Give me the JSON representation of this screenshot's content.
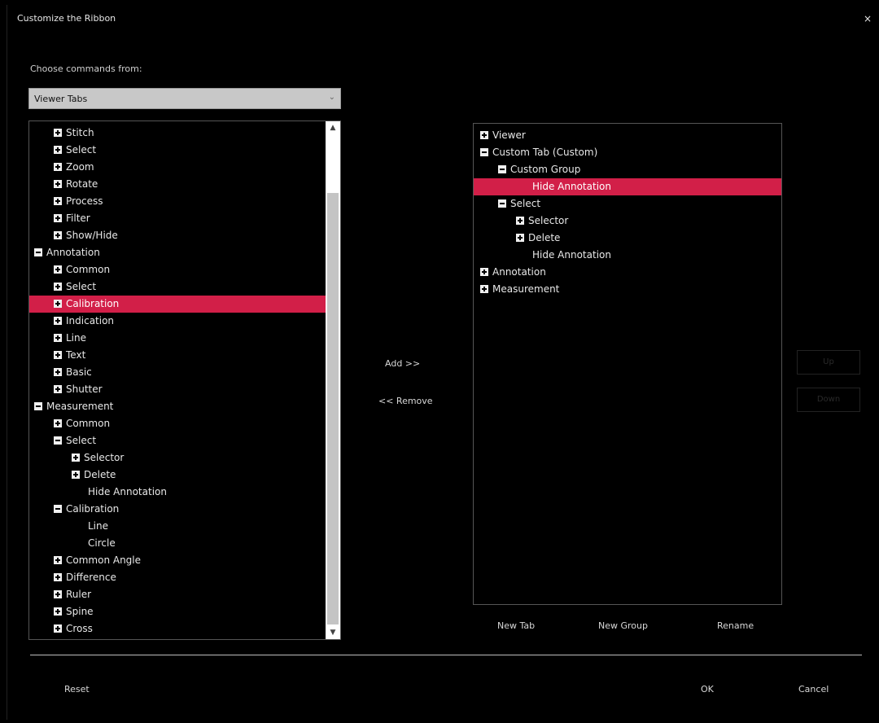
{
  "window": {
    "title": "Customize the Ribbon",
    "close_label": "×"
  },
  "choose": {
    "label": "Choose commands from:",
    "selected": "Viewer Tabs"
  },
  "left_tree": [
    {
      "label": "Stitch",
      "level": 1,
      "expander": "plus"
    },
    {
      "label": "Select",
      "level": 1,
      "expander": "plus"
    },
    {
      "label": "Zoom",
      "level": 1,
      "expander": "plus"
    },
    {
      "label": "Rotate",
      "level": 1,
      "expander": "plus"
    },
    {
      "label": "Process",
      "level": 1,
      "expander": "plus"
    },
    {
      "label": "Filter",
      "level": 1,
      "expander": "plus"
    },
    {
      "label": "Show/Hide",
      "level": 1,
      "expander": "plus"
    },
    {
      "label": "Annotation",
      "level": 0,
      "expander": "minus"
    },
    {
      "label": "Common",
      "level": 1,
      "expander": "plus"
    },
    {
      "label": "Select",
      "level": 1,
      "expander": "plus"
    },
    {
      "label": "Calibration",
      "level": 1,
      "expander": "plus",
      "selected": true
    },
    {
      "label": "Indication",
      "level": 1,
      "expander": "plus"
    },
    {
      "label": "Line",
      "level": 1,
      "expander": "plus"
    },
    {
      "label": "Text",
      "level": 1,
      "expander": "plus"
    },
    {
      "label": "Basic",
      "level": 1,
      "expander": "plus"
    },
    {
      "label": "Shutter",
      "level": 1,
      "expander": "plus"
    },
    {
      "label": "Measurement",
      "level": 0,
      "expander": "minus"
    },
    {
      "label": "Common",
      "level": 1,
      "expander": "plus"
    },
    {
      "label": "Select",
      "level": 1,
      "expander": "minus"
    },
    {
      "label": "Selector",
      "level": 2,
      "expander": "plus"
    },
    {
      "label": "Delete",
      "level": 2,
      "expander": "plus"
    },
    {
      "label": "Hide Annotation",
      "level": 3,
      "expander": "none"
    },
    {
      "label": "Calibration",
      "level": 1,
      "expander": "minus"
    },
    {
      "label": "Line",
      "level": 3,
      "expander": "none"
    },
    {
      "label": "Circle",
      "level": 3,
      "expander": "none"
    },
    {
      "label": "Common Angle",
      "level": 1,
      "expander": "plus"
    },
    {
      "label": "Difference",
      "level": 1,
      "expander": "plus"
    },
    {
      "label": "Ruler",
      "level": 1,
      "expander": "plus"
    },
    {
      "label": "Spine",
      "level": 1,
      "expander": "plus"
    },
    {
      "label": "Cross",
      "level": 1,
      "expander": "plus"
    }
  ],
  "scroll": {
    "up": "▲",
    "down": "▼"
  },
  "transfer": {
    "add": "Add >>",
    "remove": "<< Remove"
  },
  "right_tree": [
    {
      "label": "Viewer",
      "level": 0,
      "expander": "plus"
    },
    {
      "label": "Custom Tab (Custom)",
      "level": 0,
      "expander": "minus"
    },
    {
      "label": "Custom Group",
      "level": 1,
      "expander": "minus"
    },
    {
      "label": "Hide Annotation",
      "level": 3,
      "expander": "none",
      "selected": true
    },
    {
      "label": "Select",
      "level": 1,
      "expander": "minus"
    },
    {
      "label": "Selector",
      "level": 2,
      "expander": "plus"
    },
    {
      "label": "Delete",
      "level": 2,
      "expander": "plus"
    },
    {
      "label": "Hide Annotation",
      "level": 3,
      "expander": "none"
    },
    {
      "label": "Annotation",
      "level": 0,
      "expander": "plus"
    },
    {
      "label": "Measurement",
      "level": 0,
      "expander": "plus"
    }
  ],
  "order": {
    "up": "Up",
    "down": "Down"
  },
  "right_buttons": {
    "new_tab": "New Tab",
    "new_group": "New Group",
    "rename": "Rename"
  },
  "footer": {
    "reset": "Reset",
    "ok": "OK",
    "cancel": "Cancel"
  },
  "colors": {
    "selection": "#d21f48",
    "background": "#000000"
  }
}
